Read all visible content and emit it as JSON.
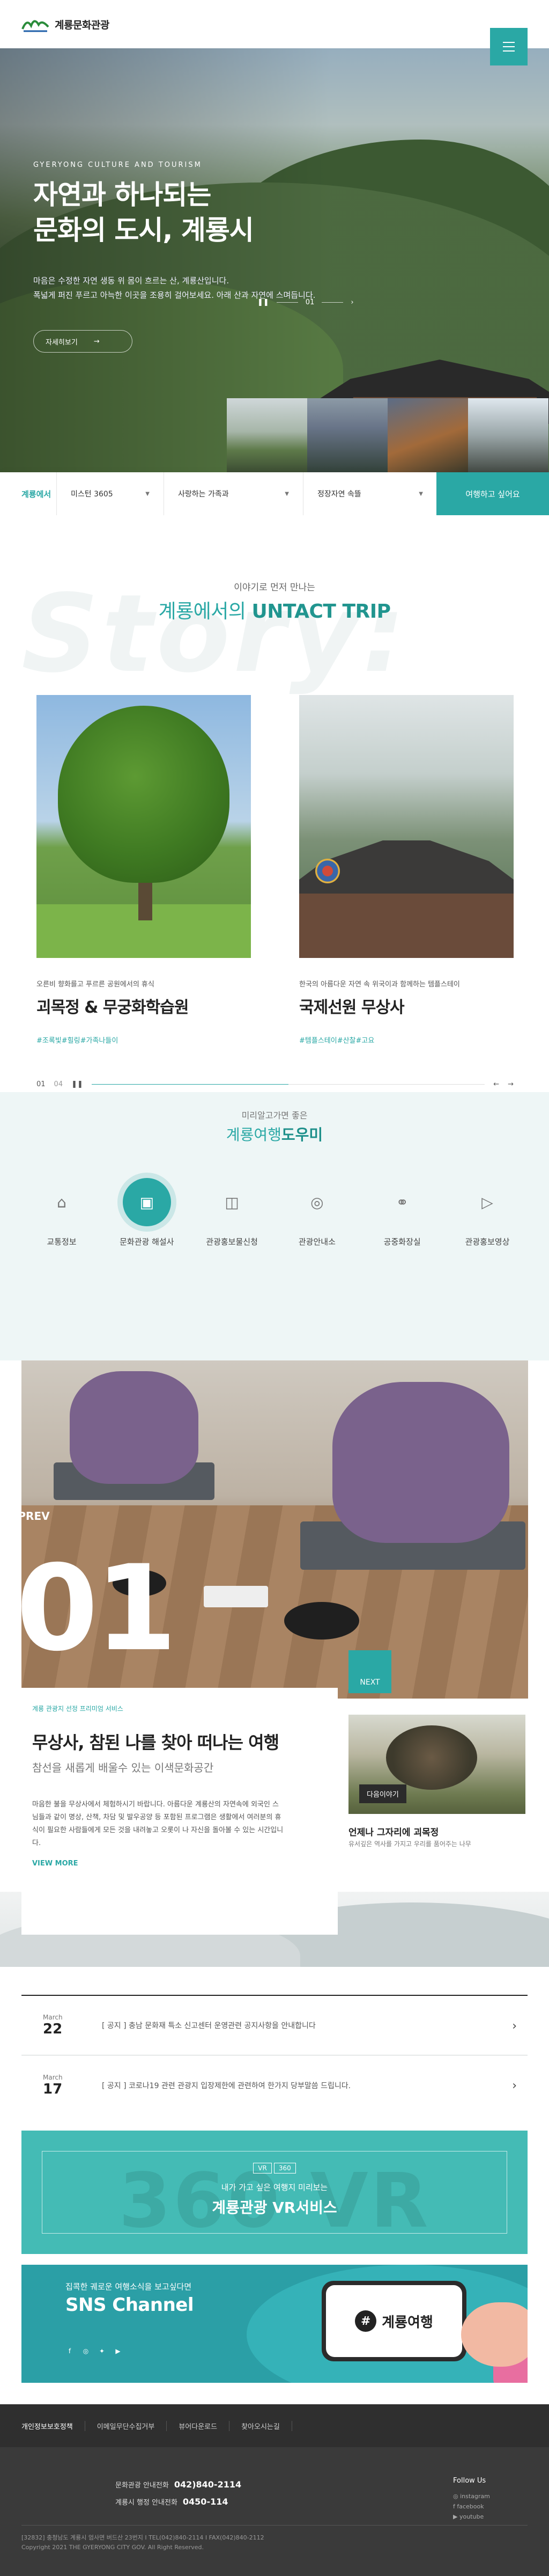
{
  "header": {
    "logo_text": "계룡문화관광",
    "menu_icon": "hamburger-menu-icon"
  },
  "hero": {
    "subtitle": "GYERYONG CULTURE AND TOURISM",
    "title_line1": "자연과 하나되는",
    "title_line2": "문화의 도시, 계룡시",
    "desc_line1": "마음은 수정한 자연 생동 위 몸이 흐르는 산, 계룡산입니다.",
    "desc_line2": "폭넓게 퍼진 푸르고 아늑한 이곳을 조용히 걸어보세요. 아래 산과 자연에 스며듭니다.",
    "slide_current": "01",
    "pause_icon": "pause-icon",
    "more_label": "자세히보기",
    "more_arrow": "→"
  },
  "search": {
    "label": "계룡에서",
    "options": [
      "미스턴 3605",
      "사랑하는 가족과",
      "정장자연 속뜰"
    ],
    "button_label": "여행하고 싶어요"
  },
  "untact": {
    "background_word": "Story:",
    "pre_title": "이야기로 먼저 만나는",
    "title_plain": "계룡에서의",
    "title_bold": "UNTACT TRIP",
    "cards": [
      {
        "small": "오른비 향화를고 푸르른 공원에서의 휴식",
        "name": "괴목정 & 무궁화학습원",
        "tags": "#조록빛#힐링#가족나들이"
      },
      {
        "small": "한국의 아름다운 자연 속 위국이과 함께하는 템플스테이",
        "name": "국제선원 무상사",
        "tags": "#템플스테이#산찰#고요"
      }
    ],
    "pager_current": "01",
    "pager_total": "04"
  },
  "helper": {
    "pre_title": "미리알고가면 좋은",
    "title_plain": "계룡여행",
    "title_bold": "도우미",
    "items": [
      {
        "label": "교통정보",
        "icon": "gamepad-icon",
        "glyph": "⌂"
      },
      {
        "label": "문화관광 해설사",
        "icon": "chat-screen-icon",
        "glyph": "▣"
      },
      {
        "label": "관광홍보물신청",
        "icon": "map-icon",
        "glyph": "◫"
      },
      {
        "label": "관광안내소",
        "icon": "location-icon",
        "glyph": "◎"
      },
      {
        "label": "공중화장실",
        "icon": "restroom-icon",
        "glyph": "⚭"
      },
      {
        "label": "관광홍보영상",
        "icon": "video-icon",
        "glyph": "▷"
      }
    ]
  },
  "stay": {
    "prev_label": "PREV",
    "big_number": "01",
    "next_label": "NEXT",
    "tag": "계룡 관광지 선정 프리미엄 서비스",
    "title": "무상사, 참된 나를 찾아 떠나는 여행",
    "subtitle": "참선을 새롭게 배울수 있는 이색문화공간",
    "desc": "마음한 불을 무상사에서 체험하시기 바랍니다. 아름다운 계룡산의 자연속에 외국인 스님들과 같이 명상, 산책, 차담 및 발우공양 등 포함된 프로그램은 생활에서 여러분의 휴식이 필요한 사람들에게 모든 것을 내려놓고 오롯이 나 자신을 돌아볼 수 있는 시간입니다.",
    "view_more": "VIEW MORE",
    "next_card_tag": "다음이야기",
    "next_card_title": "언제나 그자리에 괴목정",
    "next_card_sub": "유서깊은 역사를 가지고 우리를 품어주는 나무"
  },
  "notices": [
    {
      "month": "March",
      "day": "22",
      "text": "[ 공지 ] 충남 문화재 특소 신고센터 운영관련 공지사항을 안내합니다"
    },
    {
      "month": "March",
      "day": "17",
      "text": "[ 공지 ] 코로나19 관련 관광지 입장제한에 관련하여 한가지 당부말씀 드립니다."
    }
  ],
  "vr": {
    "badge_left": "VR",
    "badge_right": "360",
    "background_text": "360 VR",
    "subtitle": "내가 가고 싶은 여행지 미리보는",
    "title": "계룡관광 VR서비스"
  },
  "sns": {
    "pre": "집콕한 궤로운 여행소식을 보고싶다면",
    "title": "SNS Channel",
    "icons": [
      "facebook-icon",
      "instagram-icon",
      "twitter-icon",
      "youtube-icon"
    ],
    "phone_hash": "#",
    "phone_text": "계룡여행"
  },
  "footer": {
    "nav": [
      "개인정보보호정책",
      "이메일무단수집거부",
      "뷰어다운로드",
      "찾아오시는길"
    ],
    "line1_label": "문화관광 안내전화",
    "line1_value": "042)840-2114",
    "line2_label": "계룡시 행정 안내전화",
    "line2_value": "0450-114",
    "follow_label": "Follow Us",
    "social": [
      "instagram",
      "facebook",
      "youtube"
    ],
    "address": "[32832] 충청남도 계룡시 엄사면 버드산 23번지 I TEL(042)840-2114 I FAX(042)840-2112",
    "copyright": "Copyright 2021 THE GYERYONG CITY GOV. All Right Reserved."
  }
}
